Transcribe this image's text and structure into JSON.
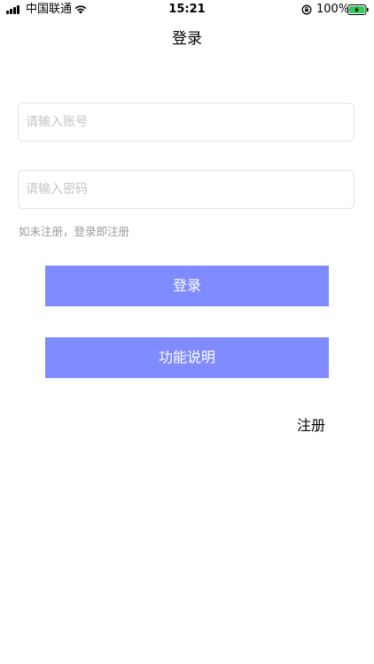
{
  "status_bar": {
    "carrier": "中国联通",
    "time": "15:21",
    "battery_percent": "100%",
    "battery_level": 1.0,
    "signal_icon": "signal-bars-icon",
    "wifi_icon": "wifi-icon",
    "orientation_icon": "orientation-lock-icon",
    "battery_icon": "battery-charging-icon",
    "battery_color": "#34c759"
  },
  "nav": {
    "title": "登录"
  },
  "form": {
    "account_placeholder": "请输入账号",
    "account_value": "",
    "password_placeholder": "请输入密码",
    "password_value": "",
    "register_hint": "如未注册，登录即注册"
  },
  "buttons": {
    "login_label": "登录",
    "help_label": "功能说明",
    "register_label": "注册",
    "accent_color": "#7f8bff"
  }
}
